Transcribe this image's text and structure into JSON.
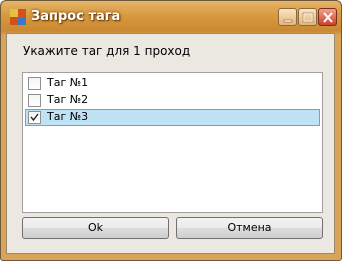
{
  "window": {
    "title": "Запрос тага",
    "controls": {
      "minimize_icon": "minimize-icon",
      "maximize_icon": "maximize-icon",
      "close_icon": "close-icon"
    }
  },
  "prompt": "Укажите таг для 1 проход",
  "list": {
    "items": [
      {
        "label": "Таг №1",
        "checked": false,
        "selected": false
      },
      {
        "label": "Таг №2",
        "checked": false,
        "selected": false
      },
      {
        "label": "Таг №3",
        "checked": true,
        "selected": true
      }
    ]
  },
  "buttons": {
    "ok_label": "Ok",
    "cancel_label": "Отмена"
  },
  "colors": {
    "title_accent": "#d99a3f",
    "selection": "#bfe2f4",
    "selection_border": "#5fa9d6",
    "client_bg": "#ebe8e1"
  }
}
